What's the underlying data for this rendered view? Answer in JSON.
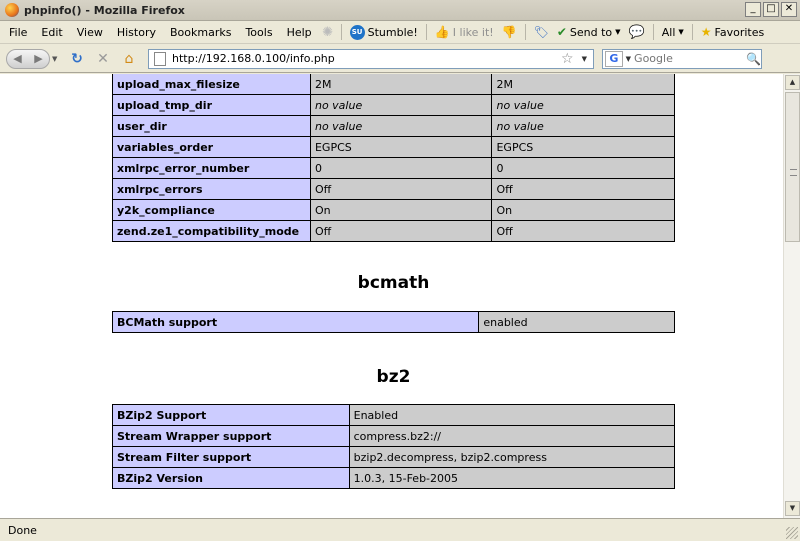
{
  "window": {
    "title": "phpinfo() - Mozilla Firefox",
    "minimize": "_",
    "maximize": "□",
    "close": "✕"
  },
  "menu": {
    "items": [
      "File",
      "Edit",
      "View",
      "History",
      "Bookmarks",
      "Tools",
      "Help"
    ],
    "stumble_label": "Stumble!",
    "like_label": "I like it!",
    "send_label": "Send to",
    "all_label": "All",
    "favorites_label": "Favorites"
  },
  "nav": {
    "url": "http://192.168.0.100/info.php",
    "search_placeholder": "Google"
  },
  "tables": {
    "core_tail": {
      "rows": [
        {
          "name": "upload_max_filesize",
          "local": "2M",
          "master": "2M"
        },
        {
          "name": "upload_tmp_dir",
          "local": "no value",
          "master": "no value"
        },
        {
          "name": "user_dir",
          "local": "no value",
          "master": "no value"
        },
        {
          "name": "variables_order",
          "local": "EGPCS",
          "master": "EGPCS"
        },
        {
          "name": "xmlrpc_error_number",
          "local": "0",
          "master": "0"
        },
        {
          "name": "xmlrpc_errors",
          "local": "Off",
          "master": "Off"
        },
        {
          "name": "y2k_compliance",
          "local": "On",
          "master": "On"
        },
        {
          "name": "zend.ze1_compatibility_mode",
          "local": "Off",
          "master": "Off"
        }
      ]
    },
    "bcmath": {
      "title": "bcmath",
      "rows": [
        {
          "name": "BCMath support",
          "value": "enabled"
        }
      ]
    },
    "bz2": {
      "title": "bz2",
      "rows": [
        {
          "name": "BZip2 Support",
          "value": "Enabled"
        },
        {
          "name": "Stream Wrapper support",
          "value": "compress.bz2://"
        },
        {
          "name": "Stream Filter support",
          "value": "bzip2.decompress, bzip2.compress"
        },
        {
          "name": "BZip2 Version",
          "value": "1.0.3, 15-Feb-2005"
        }
      ]
    }
  },
  "status": {
    "text": "Done"
  },
  "colors": {
    "label_cell": "#ccccff",
    "value_cell": "#cccccc"
  }
}
